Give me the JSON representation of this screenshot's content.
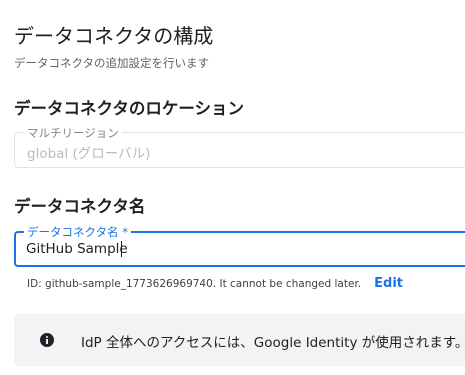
{
  "header": {
    "title": "データコネクタの構成",
    "subtitle": "データコネクタの追加設定を行います"
  },
  "location_section": {
    "heading": "データコネクタのロケーション",
    "field_label": "マルチリージョン",
    "field_value": "global (グローバル)"
  },
  "name_section": {
    "heading": "データコネクタ名",
    "field_label": "データコネクタ名 *",
    "field_value": "GitHub Sample",
    "hint": "ID: github-sample_1773626969740. It cannot be changed later.",
    "edit_label": "Edit"
  },
  "info_banner": {
    "icon": "info-icon",
    "text": "IdP 全体へのアクセスには、Google Identity が使用されます。"
  },
  "colors": {
    "accent": "#1a73e8",
    "banner_bg": "#f1f3f4",
    "disabled_text": "#b8bbbe"
  }
}
